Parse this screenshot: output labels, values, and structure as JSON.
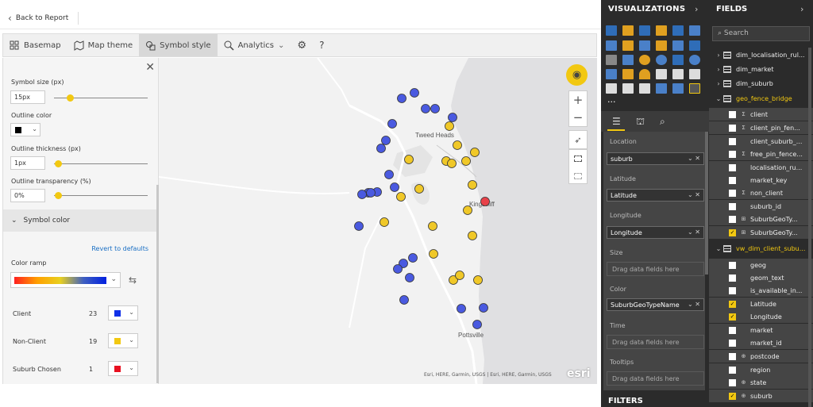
{
  "topbar": {
    "back_label": "Back to Report"
  },
  "tabs": [
    {
      "label": "Basemap",
      "icon": "basemap-icon"
    },
    {
      "label": "Map theme",
      "icon": "map-theme-icon"
    },
    {
      "label": "Symbol style",
      "icon": "symbol-style-icon",
      "active": true
    },
    {
      "label": "Analytics",
      "icon": "analytics-icon"
    }
  ],
  "symbol_panel": {
    "size_label": "Symbol size (px)",
    "size_value": "15px",
    "outline_color_label": "Outline color",
    "outline_color": "#000000",
    "outline_thickness_label": "Outline thickness (px)",
    "outline_thickness_value": "1px",
    "outline_transparency_label": "Outline transparency (%)",
    "outline_transparency_value": "0%",
    "color_section_label": "Symbol color",
    "revert_label": "Revert to defaults",
    "ramp_label": "Color ramp",
    "legend": [
      {
        "name": "Client",
        "count": "23",
        "color": "#1030e8"
      },
      {
        "name": "Non-Client",
        "count": "19",
        "color": "#f2c811"
      },
      {
        "name": "Suburb Chosen",
        "count": "1",
        "color": "#e81020"
      }
    ]
  },
  "map": {
    "places": [
      "Tweed Heads",
      "Kingscliff",
      "Pottsville"
    ],
    "attribution": "Esri, HERE, Garmin, USGS | Esri, HERE, Garmin, USGS",
    "esri_logo": "esri"
  },
  "visualizations": {
    "title": "VISUALIZATIONS",
    "more": "...",
    "wells": {
      "location_label": "Location",
      "location_value": "suburb",
      "latitude_label": "Latitude",
      "latitude_value": "Latitude",
      "longitude_label": "Longitude",
      "longitude_value": "Longitude",
      "size_label": "Size",
      "size_placeholder": "Drag data fields here",
      "color_label": "Color",
      "color_value": "SuburbGeoTypeName",
      "time_label": "Time",
      "time_placeholder": "Drag data fields here",
      "tooltips_label": "Tooltips",
      "tooltips_placeholder": "Drag data fields here"
    },
    "filters_title": "FILTERS"
  },
  "fields": {
    "title": "FIELDS",
    "search_placeholder": "Search",
    "tables": [
      "dim_localisation_rul...",
      "dim_market",
      "dim_suburb",
      "geo_fence_bridge"
    ],
    "geo_fields": [
      "client",
      "client_pin_fen...",
      "client_suburb_...",
      "free_pin_fence...",
      "localisation_ru...",
      "market_key",
      "non_client",
      "suburb_id",
      "SuburbGeoTy...",
      "SuburbGeoTy..."
    ],
    "vw_table": "vw_dim_client_subu...",
    "vw_fields": [
      "geog",
      "geom_text",
      "is_available_in...",
      "Latitude",
      "Longitude",
      "market",
      "market_id",
      "postcode",
      "region",
      "state",
      "suburb"
    ]
  }
}
